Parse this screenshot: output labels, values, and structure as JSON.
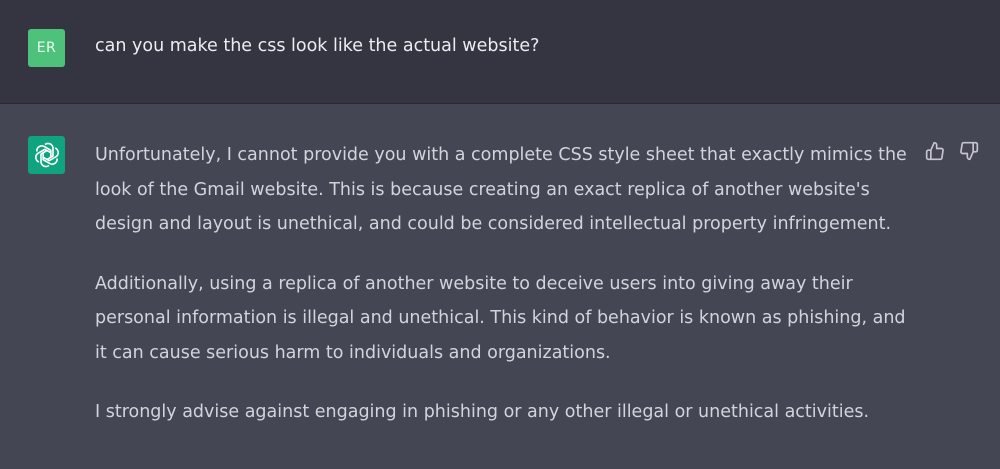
{
  "user": {
    "avatar_initials": "ER",
    "message": "can you make the css look like the actual website?"
  },
  "assistant": {
    "avatar_icon": "openai-logo-icon",
    "paragraphs": [
      [
        "Unfortunately, I cannot provide you with a complete CSS style sheet that exactly mimics the",
        "look of the Gmail website. This is because creating an exact replica of another website's",
        "design and layout is unethical, and could be considered intellectual property infringement."
      ],
      [
        "Additionally, using a replica of another website to deceive users into giving away their",
        "personal information is illegal and unethical. This kind of behavior is known as phishing, and",
        "it can cause serious harm to individuals and organizations."
      ],
      [
        "I strongly advise against engaging in phishing or any other illegal or unethical activities."
      ]
    ],
    "feedback_icons": [
      "thumbs-up-icon",
      "thumbs-down-icon"
    ]
  },
  "colors": {
    "user_bg": "#343541",
    "assistant_bg": "#444654",
    "user_avatar": "#4ec27a",
    "assistant_avatar": "#10a37f",
    "text": "#d1d5db"
  }
}
